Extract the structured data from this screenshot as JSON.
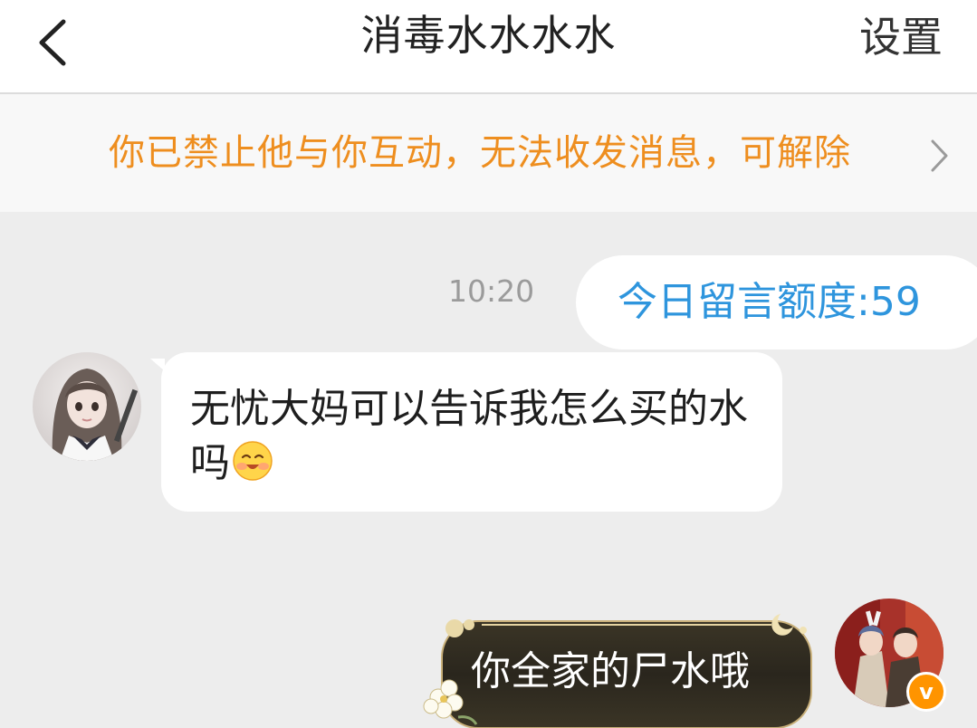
{
  "header": {
    "title": "消毒水水水水",
    "settings_label": "设置",
    "back_icon": "chevron-left-icon"
  },
  "notice": {
    "text": "你已禁止他与你互动，无法收发消息，可解除",
    "color": "#ee8e1f",
    "arrow_icon": "chevron-right-icon"
  },
  "chat": {
    "time": "10:20",
    "quota_text": "今日留言额度:59",
    "quota_color": "#2e95dd",
    "messages": [
      {
        "from": "other",
        "text": "无忧大妈可以告诉我怎么买的水吗",
        "emoji": "smiling-emoji-icon"
      },
      {
        "from": "me",
        "text": "你全家的尸水哦",
        "bubble_style": "dark-gold-decorative",
        "badge": "v"
      }
    ]
  }
}
